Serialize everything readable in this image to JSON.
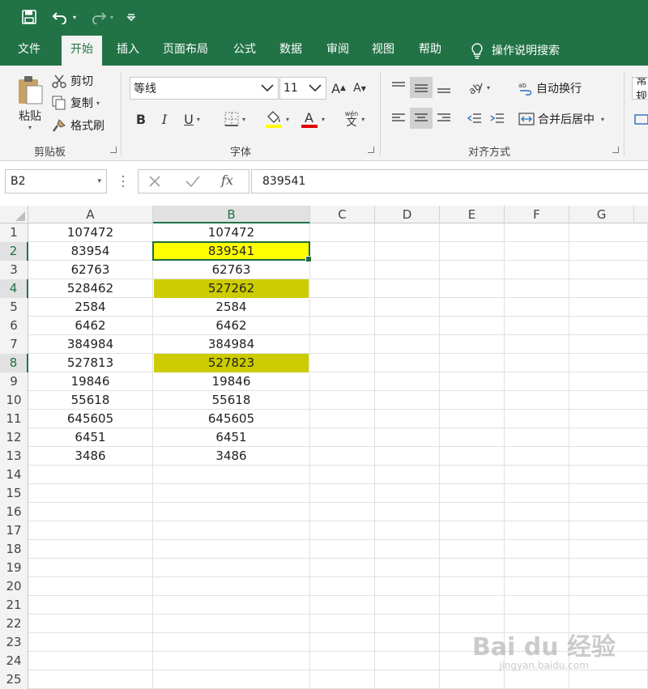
{
  "colors": {
    "accent": "#217346",
    "highlight_yellow": "#ffff00",
    "highlight_olive": "#cccc00"
  },
  "qat": {
    "save_icon": "save-icon",
    "undo_icon": "undo-icon",
    "redo_icon": "redo-icon",
    "customize_icon": "customize-qat-icon"
  },
  "tabs": [
    "文件",
    "开始",
    "插入",
    "页面布局",
    "公式",
    "数据",
    "审阅",
    "视图",
    "帮助"
  ],
  "active_tab": "开始",
  "search_label": "操作说明搜索",
  "clipboard": {
    "paste": "粘贴",
    "cut": "剪切",
    "copy": "复制",
    "format_painter": "格式刷",
    "group_label": "剪贴板"
  },
  "font": {
    "name": "等线",
    "size": "11",
    "bold": "B",
    "italic": "I",
    "underline": "U",
    "group_label": "字体",
    "grow": "A",
    "shrink": "A",
    "phonetic": "wén"
  },
  "alignment": {
    "wrap_text": "自动换行",
    "merge_center": "合并后居中",
    "group_label": "对齐方式"
  },
  "number": {
    "format": "常规"
  },
  "formula_bar": {
    "name_box": "B2",
    "formula": "839541",
    "fx": "fx"
  },
  "columns": [
    "A",
    "B",
    "C",
    "D",
    "E",
    "F",
    "G"
  ],
  "rows": [
    {
      "num": "1",
      "a": "107472",
      "b": "107472",
      "hl": ""
    },
    {
      "num": "2",
      "a": "83954",
      "b": "839541",
      "hl": "yellow"
    },
    {
      "num": "3",
      "a": "62763",
      "b": "62763",
      "hl": ""
    },
    {
      "num": "4",
      "a": "528462",
      "b": "527262",
      "hl": "olive"
    },
    {
      "num": "5",
      "a": "2584",
      "b": "2584",
      "hl": ""
    },
    {
      "num": "6",
      "a": "6462",
      "b": "6462",
      "hl": ""
    },
    {
      "num": "7",
      "a": "384984",
      "b": "384984",
      "hl": ""
    },
    {
      "num": "8",
      "a": "527813",
      "b": "527823",
      "hl": "olive"
    },
    {
      "num": "9",
      "a": "19846",
      "b": "19846",
      "hl": ""
    },
    {
      "num": "10",
      "a": "55618",
      "b": "55618",
      "hl": ""
    },
    {
      "num": "11",
      "a": "645605",
      "b": "645605",
      "hl": ""
    },
    {
      "num": "12",
      "a": "6451",
      "b": "6451",
      "hl": ""
    },
    {
      "num": "13",
      "a": "3486",
      "b": "3486",
      "hl": ""
    },
    {
      "num": "14",
      "a": "",
      "b": "",
      "hl": ""
    },
    {
      "num": "15",
      "a": "",
      "b": "",
      "hl": ""
    },
    {
      "num": "16",
      "a": "",
      "b": "",
      "hl": ""
    },
    {
      "num": "17",
      "a": "",
      "b": "",
      "hl": ""
    },
    {
      "num": "18",
      "a": "",
      "b": "",
      "hl": ""
    },
    {
      "num": "19",
      "a": "",
      "b": "",
      "hl": ""
    },
    {
      "num": "20",
      "a": "",
      "b": "",
      "hl": ""
    },
    {
      "num": "21",
      "a": "",
      "b": "",
      "hl": ""
    },
    {
      "num": "22",
      "a": "",
      "b": "",
      "hl": ""
    },
    {
      "num": "23",
      "a": "",
      "b": "",
      "hl": ""
    },
    {
      "num": "24",
      "a": "",
      "b": "",
      "hl": ""
    },
    {
      "num": "25",
      "a": "",
      "b": "",
      "hl": ""
    }
  ],
  "selected_cell": "B2",
  "watermark": {
    "brand": "Bai du 经验",
    "url": "jingyan.baidu.com"
  }
}
